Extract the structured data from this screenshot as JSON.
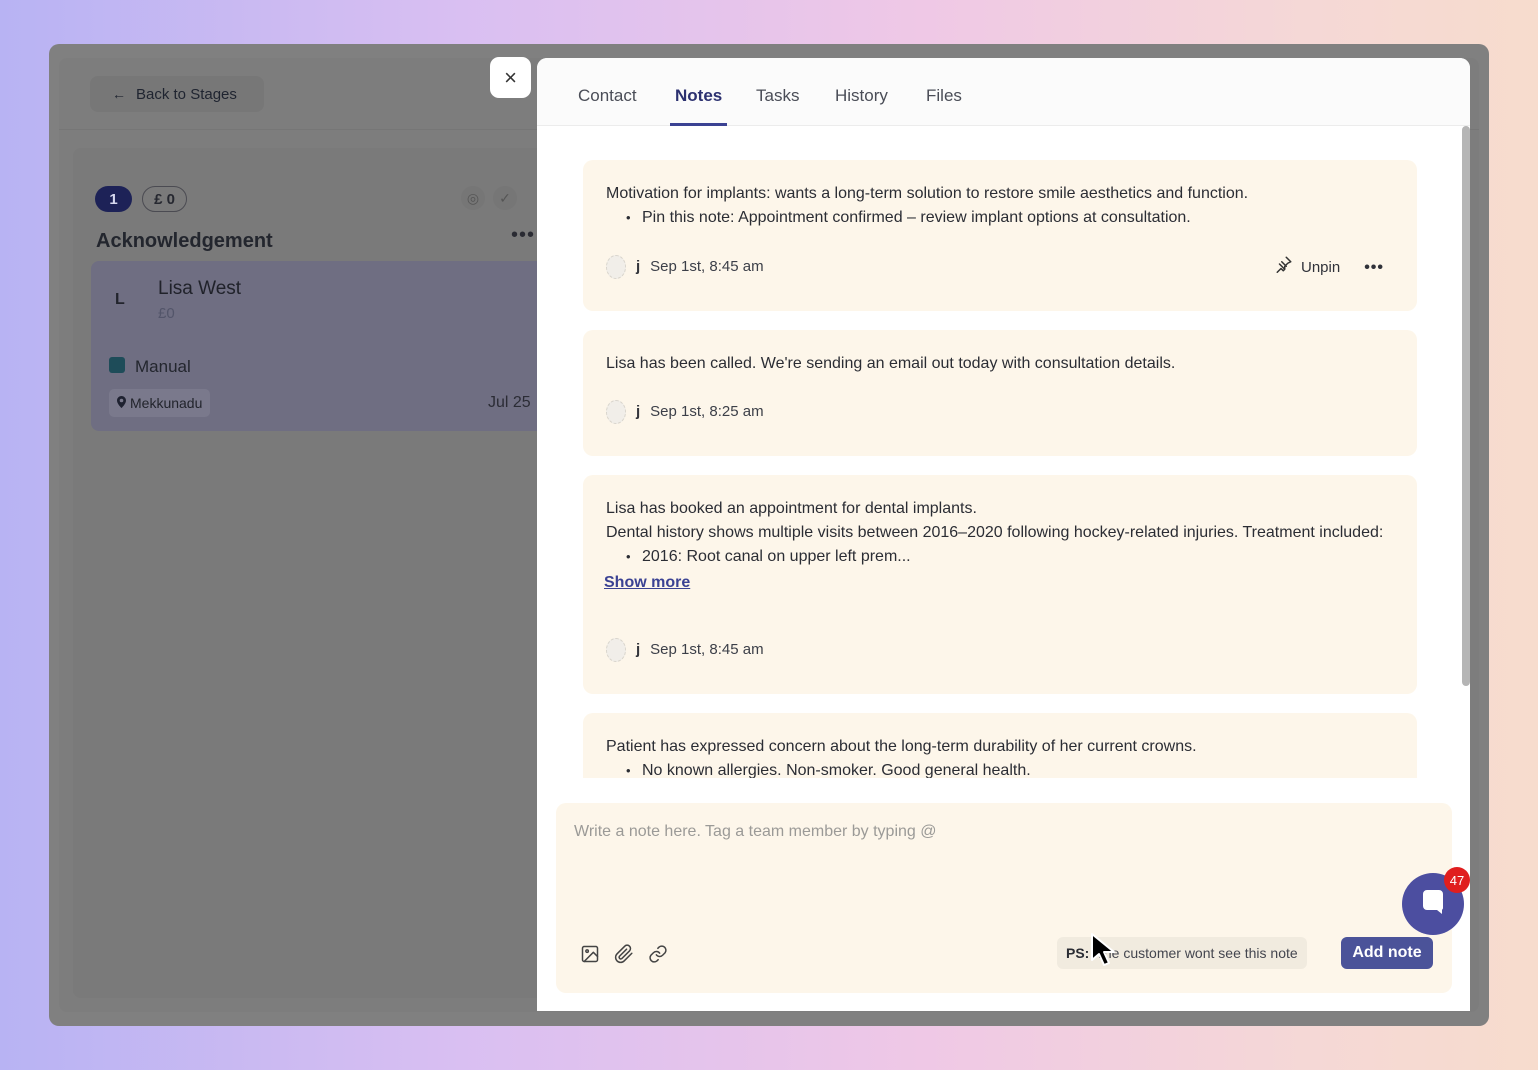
{
  "background": {
    "back_button": "Back to Stages",
    "stage": {
      "count": "1",
      "value": "£ 0",
      "title": "Acknowledgement",
      "more": "•••",
      "deal": {
        "avatar_initial": "L",
        "name": "Lisa West",
        "amount": "£0",
        "source": "Manual",
        "location": "Mekkunadu",
        "date": "Jul 25"
      }
    }
  },
  "drawer": {
    "close_icon": "×",
    "tabs": [
      {
        "label": "Contact",
        "active": false
      },
      {
        "label": "Notes",
        "active": true
      },
      {
        "label": "Tasks",
        "active": false
      },
      {
        "label": "History",
        "active": false
      },
      {
        "label": "Files",
        "active": false
      }
    ],
    "notes": [
      {
        "text": "Motivation for implants: wants a long-term solution to restore smile aesthetics and function.",
        "bullets": [
          "Pin this note: Appointment confirmed – review implant options at consultation."
        ],
        "author": "j",
        "timestamp": "Sep 1st, 8:45 am",
        "pin_label": "Unpin",
        "more": "•••"
      },
      {
        "text": "Lisa has been called. We're sending an email out today with consultation details.",
        "author": "j",
        "timestamp": "Sep 1st, 8:25 am"
      },
      {
        "line1": "Lisa has booked an appointment for dental implants.",
        "line2": "Dental history shows multiple visits between 2016–2020 following hockey-related injuries. Treatment included:",
        "bullets": [
          "2016: Root canal on upper left prem..."
        ],
        "show_more": "Show more",
        "author": "j",
        "timestamp": "Sep 1st, 8:45 am"
      },
      {
        "text": "Patient has expressed concern about the long-term durability of her current crowns.",
        "bullets": [
          "No known allergies. Non-smoker. Good general health."
        ]
      }
    ],
    "composer": {
      "placeholder": "Write a note here. Tag a team member by typing @",
      "ps_label": "PS:",
      "ps_text": "The customer wont see this note",
      "add_button": "Add note"
    }
  },
  "chat": {
    "badge_count": "47"
  },
  "colors": {
    "accent": "#4b5399",
    "note_bg": "#fdf6ea",
    "badge": "#e01e1e"
  }
}
